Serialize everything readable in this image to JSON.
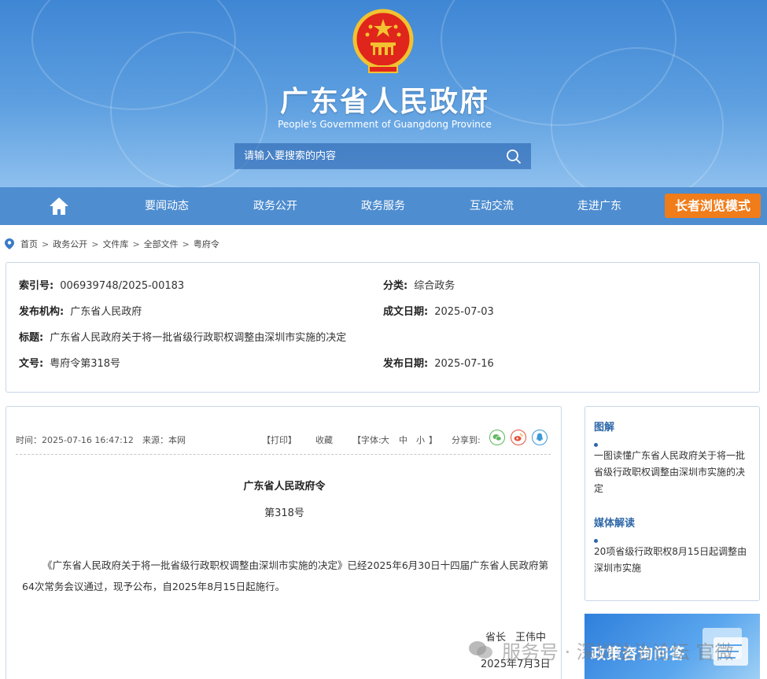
{
  "header": {
    "site_title": "广东省人民政府",
    "site_subtitle": "People's Government of Guangdong Province",
    "search_placeholder": "请输入要搜索的内容"
  },
  "nav": {
    "items": [
      "要闻动态",
      "政务公开",
      "政务服务",
      "互动交流",
      "走进广东"
    ],
    "elder_mode": "长者浏览模式"
  },
  "breadcrumb": [
    "首页",
    "政务公开",
    "文件库",
    "全部文件",
    "粤府令"
  ],
  "info": {
    "index_label": "索引号:",
    "index_value": "006939748/2025-00183",
    "category_label": "分类:",
    "category_value": "综合政务",
    "publisher_label": "发布机构:",
    "publisher_value": "广东省人民政府",
    "written_date_label": "成文日期:",
    "written_date_value": "2025-07-03",
    "title_label": "标题:",
    "title_value": "广东省人民政府关于将一批省级行政职权调整由深圳市实施的决定",
    "doc_no_label": "文号:",
    "doc_no_value": "粤府令第318号",
    "publish_date_label": "发布日期:",
    "publish_date_value": "2025-07-16"
  },
  "article": {
    "time": "时间：2025-07-16 16:47:12",
    "source": "来源：本网",
    "print": "【打印】",
    "favorite": "收藏",
    "font_open": "【字体:",
    "font_large": "大",
    "font_medium": "中",
    "font_small": "小",
    "font_close": "】",
    "share": "分享到:",
    "doc_title": "广东省人民政府令",
    "doc_number": "第318号",
    "body": "《广东省人民政府关于将一批省级行政职权调整由深圳市实施的决定》已经2025年6月30日十四届广东省人民政府第64次常务会议通过，现予公布，自2025年8月15日起施行。",
    "signer_title": "省长",
    "signer_name": "王伟中",
    "sign_date": "2025年7月3日"
  },
  "sidebar": {
    "section1_title": "图解",
    "section1_item": "一图读懂广东省人民政府关于将一批省级行政职权调整由深圳市实施的决定",
    "section2_title": "媒体解读",
    "section2_item": "20项省级行政职权8月15日起调整由深圳市实施",
    "promo_text": "政策咨询问答"
  },
  "watermark": {
    "text": "服务号 · 深圳法治论坛 官微"
  },
  "colors": {
    "banner": "#3f86d4",
    "nav": "#4e8dd0",
    "elder_button": "#f07c1a",
    "link_blue": "#2e67a8"
  }
}
